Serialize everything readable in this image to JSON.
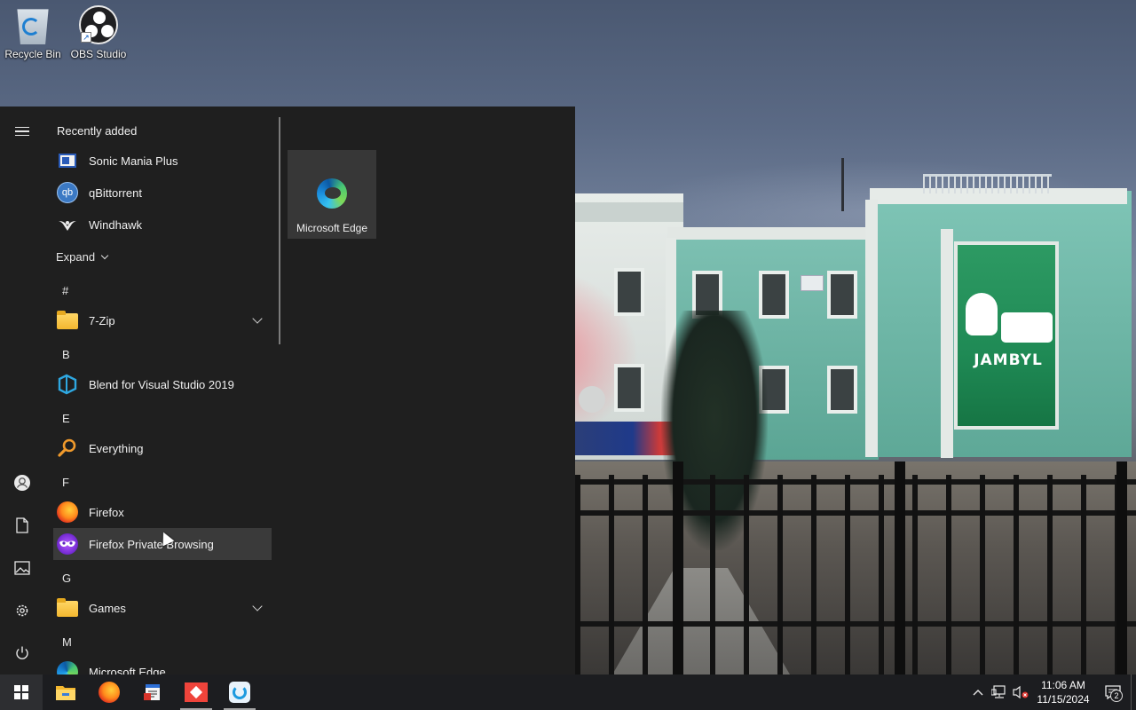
{
  "desktop": {
    "icons": [
      {
        "label": "Recycle Bin",
        "icon": "recycle-bin-icon"
      },
      {
        "label": "OBS Studio",
        "icon": "obs-studio-icon"
      }
    ],
    "wallpaper_sign": "JAMBYL"
  },
  "start_menu": {
    "rail": [
      {
        "name": "menu-icon"
      },
      {
        "name": "user-icon"
      },
      {
        "name": "documents-icon"
      },
      {
        "name": "pictures-icon"
      },
      {
        "name": "settings-icon"
      },
      {
        "name": "power-icon"
      }
    ],
    "recently_added_title": "Recently added",
    "recently_added": [
      {
        "label": "Sonic Mania Plus",
        "icon": "sonic-mania-icon"
      },
      {
        "label": "qBittorrent",
        "icon": "qbittorrent-icon",
        "glyph": "qb"
      },
      {
        "label": "Windhawk",
        "icon": "windhawk-icon"
      }
    ],
    "expand_label": "Expand",
    "groups": [
      {
        "letter": "#",
        "apps": [
          {
            "label": "7-Zip",
            "icon": "folder-icon",
            "expandable": true
          }
        ]
      },
      {
        "letter": "B",
        "apps": [
          {
            "label": "Blend for Visual Studio 2019",
            "icon": "blend-icon"
          }
        ]
      },
      {
        "letter": "E",
        "apps": [
          {
            "label": "Everything",
            "icon": "everything-search-icon"
          }
        ]
      },
      {
        "letter": "F",
        "apps": [
          {
            "label": "Firefox",
            "icon": "firefox-icon"
          },
          {
            "label": "Firefox Private Browsing",
            "icon": "firefox-private-icon",
            "hovered": true
          }
        ]
      },
      {
        "letter": "G",
        "apps": [
          {
            "label": "Games",
            "icon": "folder-icon",
            "expandable": true
          }
        ]
      },
      {
        "letter": "M",
        "apps": [
          {
            "label": "Microsoft Edge",
            "icon": "edge-icon"
          }
        ]
      }
    ],
    "tiles": [
      {
        "label": "Microsoft Edge",
        "icon": "edge-icon"
      }
    ]
  },
  "taskbar": {
    "pinned": [
      {
        "name": "file-explorer",
        "icon": "folder-icon"
      },
      {
        "name": "firefox",
        "icon": "firefox-icon"
      },
      {
        "name": "notepad-app",
        "icon": "notepad-icon"
      },
      {
        "name": "anydesk",
        "icon": "anydesk-icon"
      },
      {
        "name": "sync-app",
        "icon": "sync-icon",
        "active": true
      }
    ],
    "tray": {
      "chevron": "^",
      "time": "11:06 AM",
      "date": "11/15/2024",
      "notification_count": "2"
    }
  },
  "colors": {
    "start_bg": "#1f1f1f",
    "tile_bg": "#373737",
    "hover_bg": "#3a3a3a",
    "taskbar_bg": "#1c1d20"
  }
}
